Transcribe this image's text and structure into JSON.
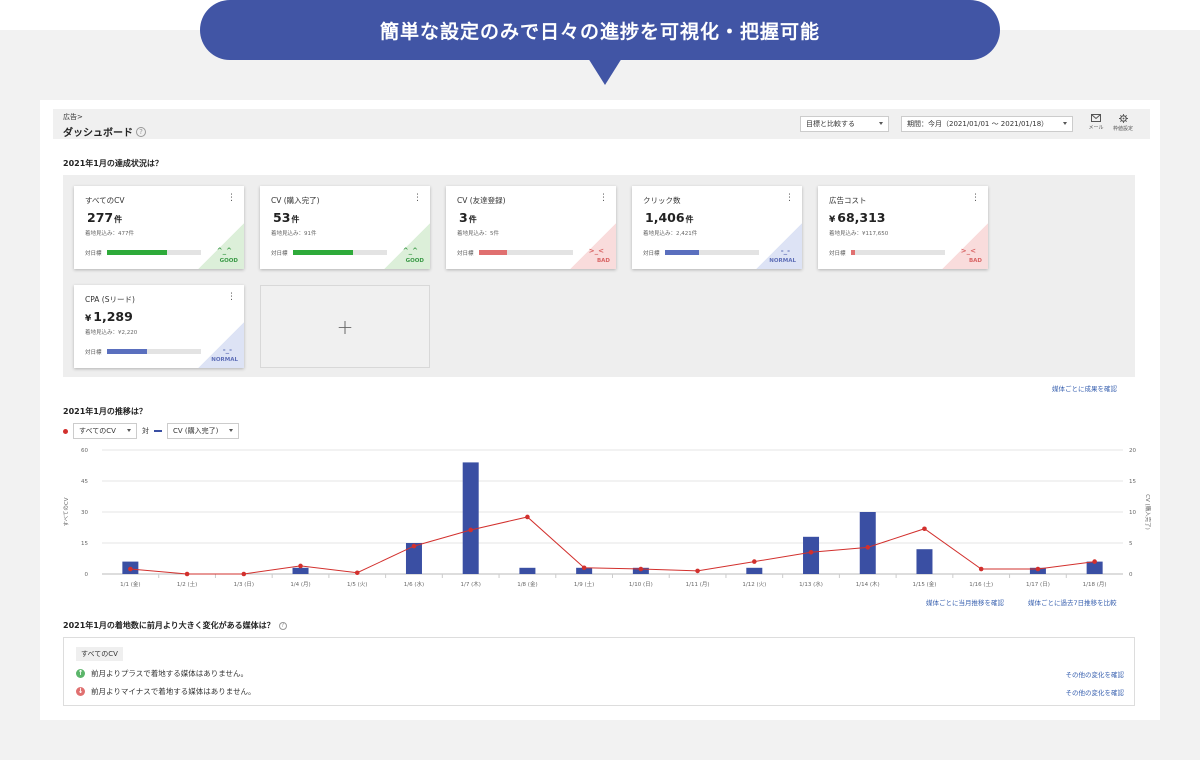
{
  "banner": {
    "text": "簡単な設定のみで日々の進捗を可視化・把握可能"
  },
  "header": {
    "breadcrumb": "広告>",
    "title": "ダッシュボード",
    "compare_select": "目標と比較する",
    "period_select": "期間：今月（2021/01/01 〜 2021/01/18）",
    "mail_label": "メール",
    "settings_label": "枠値設定"
  },
  "achievement": {
    "title": "2021年1月の達成状況は？",
    "bar_label": "対日標",
    "cards": [
      {
        "title": "すべてのCV",
        "value": "277",
        "unit": "件",
        "prefix": "",
        "sub": "着地見込み：477件",
        "progress": 0.64,
        "status": "GOOD",
        "face": "^_^",
        "color": "#2eaa3a",
        "status_color": "#3b9a47"
      },
      {
        "title": "CV (購入完了)",
        "value": "53",
        "unit": "件",
        "prefix": "",
        "sub": "着地見込み：91件",
        "progress": 0.64,
        "status": "GOOD",
        "face": "^_^",
        "color": "#2eaa3a",
        "status_color": "#3b9a47"
      },
      {
        "title": "CV (友達登録)",
        "value": "3",
        "unit": "件",
        "prefix": "",
        "sub": "着地見込み：5件",
        "progress": 0.3,
        "status": "BAD",
        "face": ">_<",
        "color": "#e07070",
        "status_color": "#d86464"
      },
      {
        "title": "クリック数",
        "value": "1,406",
        "unit": "件",
        "prefix": "",
        "sub": "着地見込み：2,421件",
        "progress": 0.36,
        "status": "NORMAL",
        "face": "-_-",
        "color": "#5a6fbe",
        "status_color": "#6070b8"
      },
      {
        "title": "広告コスト",
        "value": "68,313",
        "unit": "",
        "prefix": "¥",
        "sub": "着地見込み：¥117,650",
        "progress": 0.04,
        "status": "BAD",
        "face": ">_<",
        "color": "#e07070",
        "status_color": "#d86464"
      },
      {
        "title": "CPA (Sリード)",
        "value": "1,289",
        "unit": "",
        "prefix": "¥",
        "sub": "着地見込み：¥2,220",
        "progress": 0.43,
        "status": "NORMAL",
        "face": "-_-",
        "color": "#5a6fbe",
        "status_color": "#6070b8"
      }
    ],
    "add_symbol": "+",
    "media_link": "媒体ごとに成果を確認"
  },
  "trend": {
    "title": "2021年1月の推移は？",
    "select_left": "すべてのCV",
    "vs_label": "対",
    "select_right": "CV (購入完了)",
    "link_month": "媒体ごとに当月推移を確認",
    "link_compare": "媒体ごとに過去7日推移を比較"
  },
  "chart_data": {
    "type": "bar",
    "x": [
      "1/1 (金)",
      "1/2 (土)",
      "1/3 (日)",
      "1/4 (月)",
      "1/5 (火)",
      "1/6 (水)",
      "1/7 (木)",
      "1/8 (金)",
      "1/9 (土)",
      "1/10 (日)",
      "1/11 (月)",
      "1/12 (火)",
      "1/13 (水)",
      "1/14 (木)",
      "1/15 (金)",
      "1/16 (土)",
      "1/17 (日)",
      "1/18 (月)"
    ],
    "ylabel": "すべてのCV",
    "y2label": "CV (購入完了)",
    "ylim": [
      0,
      60
    ],
    "y2lim": [
      0,
      20
    ],
    "yticks": [
      0,
      15,
      30,
      45,
      60
    ],
    "y2ticks": [
      0,
      5,
      10,
      15,
      20
    ],
    "grid": true,
    "series": [
      {
        "name": "すべてのCV",
        "type": "bar",
        "axis": "left",
        "color": "#3a4fa3",
        "values": [
          6,
          0,
          0,
          3,
          0,
          15,
          54,
          3,
          3,
          3,
          0,
          3,
          18,
          30,
          12,
          0,
          3,
          6
        ]
      },
      {
        "name": "CV (購入完了)",
        "type": "line",
        "axis": "right",
        "color": "#d2302d",
        "values": [
          0.8,
          0,
          0,
          1.3,
          0.2,
          4.5,
          7.1,
          9.2,
          1,
          0.8,
          0.5,
          2,
          3.5,
          4.3,
          7.3,
          0.8,
          0.8,
          2
        ]
      }
    ]
  },
  "changes": {
    "title": "2021年1月の着地数に前月より大きく変化がある媒体は？",
    "chip": "すべてのCV",
    "plus_text": "前月よりプラスで着地する媒体はありません。",
    "minus_text": "前月よりマイナスで着地する媒体はありません。",
    "link": "その他の変化を確認",
    "plus_color": "#5bb56a",
    "minus_color": "#e07070"
  }
}
